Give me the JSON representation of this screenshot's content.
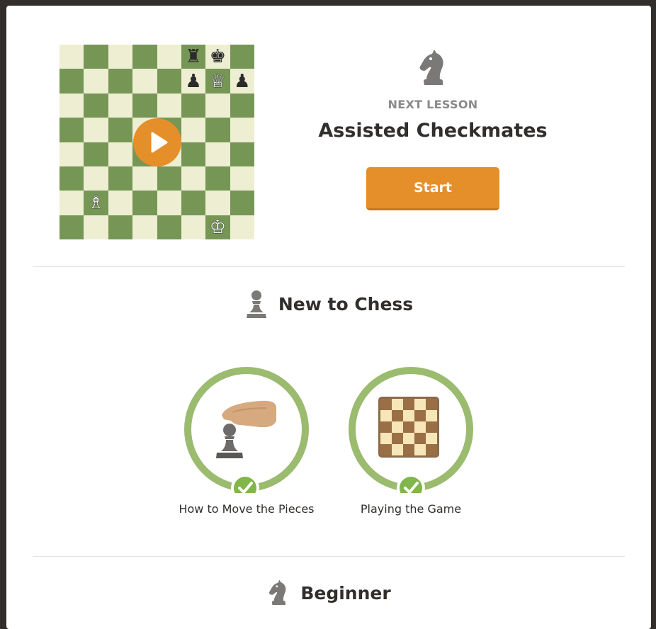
{
  "next_lesson": {
    "label": "NEXT LESSON",
    "title": "Assisted Checkmates",
    "start_label": "Start",
    "board": [
      [
        "",
        "",
        "",
        "",
        "",
        "♜",
        "♚",
        ""
      ],
      [
        "",
        "",
        "",
        "",
        "",
        "♟",
        "♕",
        "♟"
      ],
      [
        "",
        "",
        "",
        "",
        "",
        "",
        "",
        ""
      ],
      [
        "",
        "",
        "",
        "",
        "",
        "",
        "",
        ""
      ],
      [
        "",
        "",
        "",
        "",
        "",
        "",
        "",
        ""
      ],
      [
        "",
        "",
        "",
        "",
        "",
        "",
        "",
        ""
      ],
      [
        "",
        "♗",
        "",
        "",
        "",
        "",
        "",
        ""
      ],
      [
        "",
        "",
        "",
        "",
        "",
        "",
        "♔",
        ""
      ]
    ]
  },
  "sections": [
    {
      "title": "New to Chess",
      "icon": "pawn-icon",
      "lessons": [
        {
          "label": "How to Move the Pieces",
          "completed": true,
          "icon": "hand-pawn-icon"
        },
        {
          "label": "Playing the Game",
          "completed": true,
          "icon": "chessboard-icon"
        }
      ]
    },
    {
      "title": "Beginner",
      "icon": "knight-icon",
      "lessons": []
    }
  ],
  "colors": {
    "accent": "#e58f2a",
    "ring": "#9bbb6f",
    "check": "#81b64c",
    "board_light": "#eeeed2",
    "board_dark": "#769656",
    "icon_gray": "#7b7977"
  }
}
